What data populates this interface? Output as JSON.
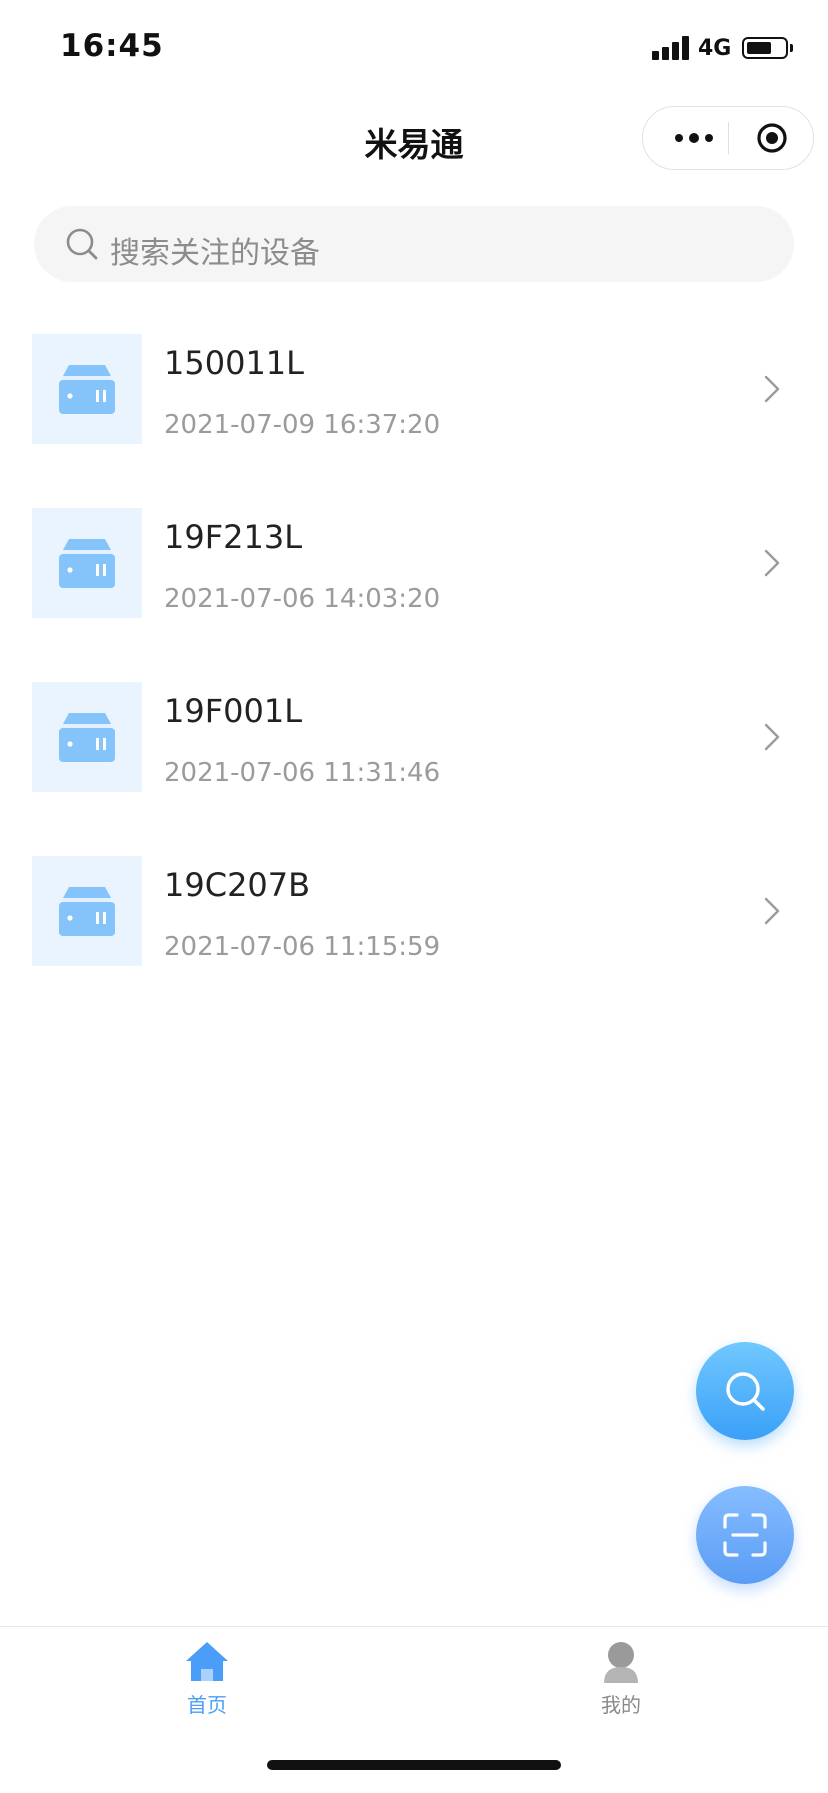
{
  "status_bar": {
    "time": "16:45",
    "network": "4G",
    "battery_icon": "battery-icon",
    "signal_icon": "signal-icon"
  },
  "nav": {
    "title": "米易通",
    "more_icon": "more-dots-icon",
    "close_icon": "target-circle-icon"
  },
  "search": {
    "placeholder": "搜索关注的设备",
    "icon": "search-icon"
  },
  "devices": [
    {
      "name": "150011L",
      "time": "2021-07-09 16:37:20"
    },
    {
      "name": "19F213L",
      "time": "2021-07-06 14:03:20"
    },
    {
      "name": "19F001L",
      "time": "2021-07-06 11:31:46"
    },
    {
      "name": "19C207B",
      "time": "2021-07-06 11:15:59"
    }
  ],
  "fabs": {
    "search_icon": "search-icon",
    "scan_icon": "scan-icon"
  },
  "tabbar": {
    "tabs": [
      {
        "label": "首页",
        "icon": "home-icon",
        "active": true
      },
      {
        "label": "我的",
        "icon": "user-icon",
        "active": false
      }
    ]
  },
  "colors": {
    "accent": "#4a9ef7",
    "thumb_bg": "#eaf4ff",
    "device_icon": "#85c3fb",
    "inactive": "#8a8a8a"
  }
}
